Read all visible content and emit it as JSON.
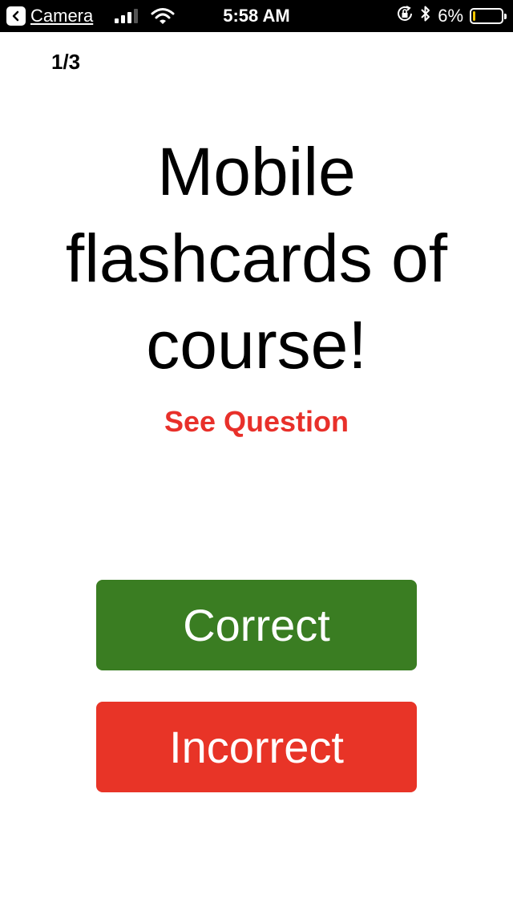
{
  "status_bar": {
    "back_label": "Camera",
    "time": "5:58 AM",
    "battery_percent": "6%",
    "battery_level": 0.06,
    "battery_color": "#f2c600",
    "icons": [
      "back-chevron-icon",
      "signal-icon",
      "wifi-icon",
      "orientation-lock-icon",
      "bluetooth-icon",
      "battery-icon"
    ]
  },
  "flashcard": {
    "counter": "1/3",
    "text": "Mobile flashcards of course!",
    "toggle_label": "See Question"
  },
  "actions": {
    "correct_label": "Correct",
    "incorrect_label": "Incorrect"
  },
  "colors": {
    "correct": "#3a7d22",
    "incorrect": "#e83427",
    "toggle": "#e8302a"
  }
}
